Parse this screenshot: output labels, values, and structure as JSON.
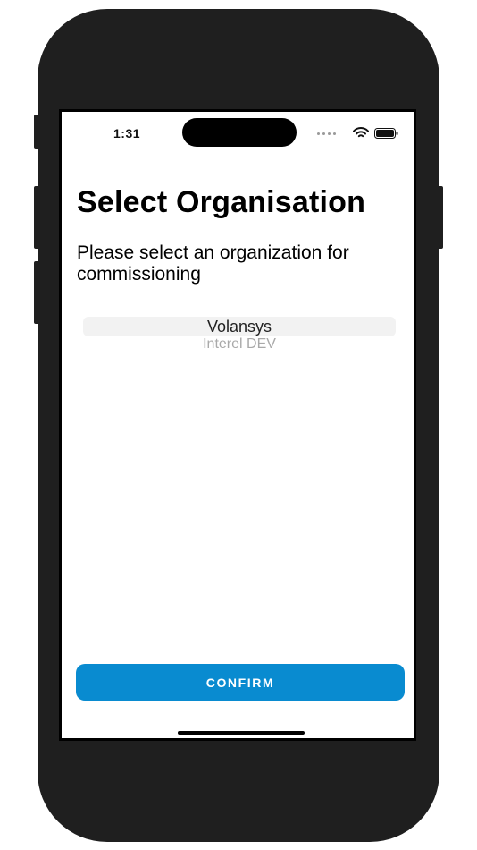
{
  "status_bar": {
    "time": "1:31",
    "icons": [
      "cellular-signal-icon",
      "wifi-icon",
      "battery-icon"
    ]
  },
  "page": {
    "title": "Select Organisation",
    "subtitle": "Please select an organization for commissioning"
  },
  "picker": {
    "selected": "Volansys",
    "options": [
      "Volansys",
      "Interel DEV"
    ]
  },
  "actions": {
    "confirm_label": "CONFIRM"
  },
  "colors": {
    "accent": "#098bd0",
    "device_frame": "#1f1f1f"
  }
}
